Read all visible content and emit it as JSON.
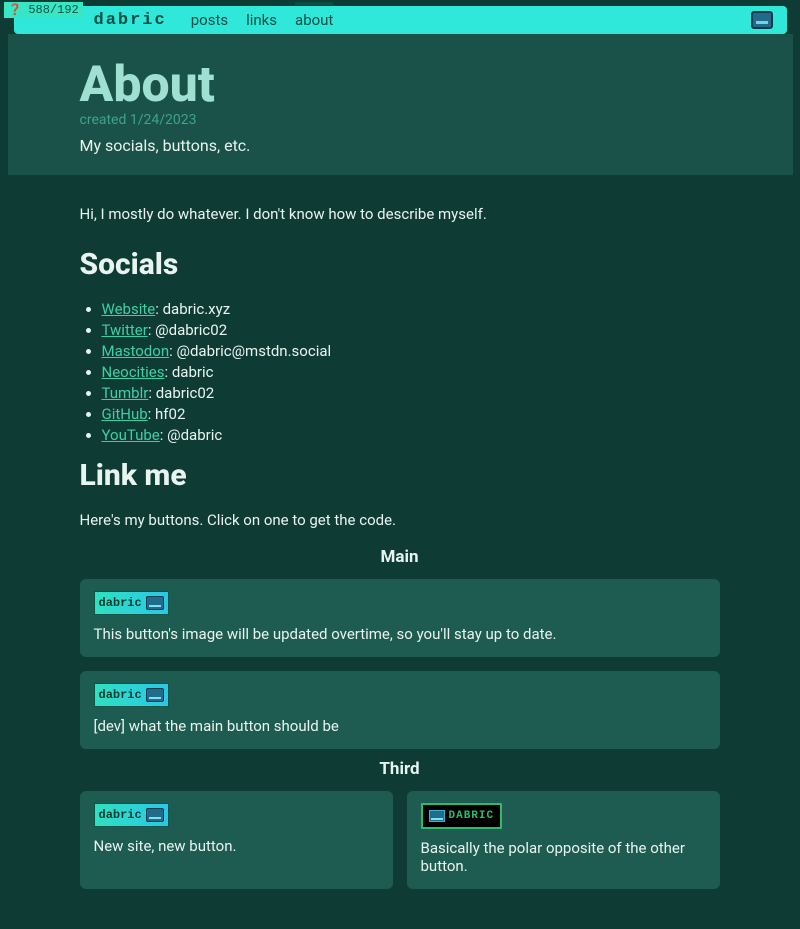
{
  "coord_overlay": "588/192",
  "nav": {
    "brand": "dabric",
    "items": [
      "posts",
      "links",
      "about"
    ],
    "active_index": 2
  },
  "header": {
    "title": "About",
    "created": "created 1/24/2023",
    "subtitle": "My socials, buttons, etc."
  },
  "intro": "Hi, I mostly do whatever. I don't know how to describe myself.",
  "socials_heading": "Socials",
  "socials": [
    {
      "label": "Website",
      "value": "dabric.xyz"
    },
    {
      "label": "Twitter",
      "value": "@dabric02"
    },
    {
      "label": "Mastodon",
      "value": "@dabric@mstdn.social"
    },
    {
      "label": "Neocities",
      "value": "dabric"
    },
    {
      "label": "Tumblr",
      "value": "dabric02"
    },
    {
      "label": "GitHub",
      "value": "hf02"
    },
    {
      "label": "YouTube",
      "value": "@dabric"
    }
  ],
  "linkme": {
    "heading": "Link me",
    "desc": "Here's my buttons. Click on one to get the code."
  },
  "button_groups": [
    {
      "title": "Main",
      "layout": "column",
      "cards": [
        {
          "badge_style": "light",
          "badge_text": "dabric",
          "desc": "This button's image will be updated overtime, so you'll stay up to date."
        },
        {
          "badge_style": "light",
          "badge_text": "dabric",
          "desc": "[dev] what the main button should be"
        }
      ]
    },
    {
      "title": "Third",
      "layout": "row",
      "cards": [
        {
          "badge_style": "light",
          "badge_text": "dabric",
          "desc": "New site, new button."
        },
        {
          "badge_style": "dark",
          "badge_text": "DABRIC",
          "desc": "Basically the polar opposite of the other button."
        }
      ]
    }
  ]
}
